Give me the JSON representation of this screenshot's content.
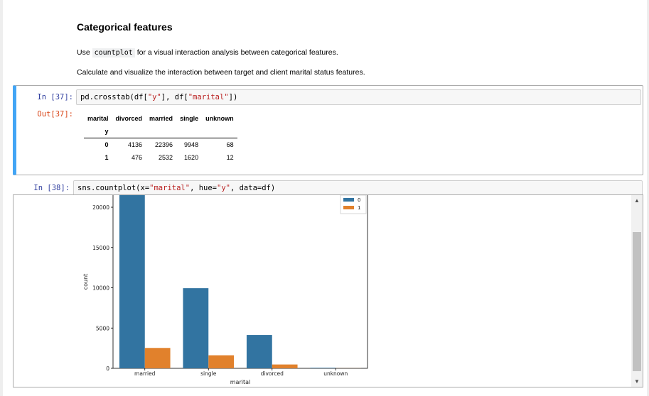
{
  "markdown": {
    "heading": "Categorical features",
    "para1_before": "Use ",
    "para1_code": "countplot",
    "para1_after": " for a visual interaction analysis between categorical features.",
    "para2": "Calculate and visualize the interaction between target and client marital status features."
  },
  "cell37": {
    "in_prompt": "In [37]:",
    "out_prompt": "Out[37]:",
    "code_prefix": "pd.crosstab(df[",
    "code_s1": "\"y\"",
    "code_mid": "], df[",
    "code_s2": "\"marital\"",
    "code_suffix": "])",
    "table": {
      "corner_label": "marital",
      "columns": [
        "divorced",
        "married",
        "single",
        "unknown"
      ],
      "index_label": "y",
      "rows": [
        {
          "index": "0",
          "values": [
            "4136",
            "22396",
            "9948",
            "68"
          ]
        },
        {
          "index": "1",
          "values": [
            "476",
            "2532",
            "1620",
            "12"
          ]
        }
      ]
    }
  },
  "cell38": {
    "in_prompt": "In [38]:",
    "code_prefix": "sns.countplot(x=",
    "code_s1": "\"marital\"",
    "code_mid": ", hue=",
    "code_s2": "\"y\"",
    "code_suffix": ", data=df)"
  },
  "chart_data": {
    "type": "bar",
    "categories": [
      "married",
      "single",
      "divorced",
      "unknown"
    ],
    "series": [
      {
        "name": "0",
        "values": [
          22396,
          9948,
          4136,
          68
        ],
        "color": "#3274a1"
      },
      {
        "name": "1",
        "values": [
          2532,
          1620,
          476,
          12
        ],
        "color": "#e1812c"
      }
    ],
    "xlabel": "marital",
    "ylabel": "count",
    "yticks": [
      0,
      5000,
      10000,
      15000,
      20000
    ],
    "ylim": [
      0,
      21500
    ],
    "legend_placement": "top-right",
    "grid": false
  },
  "colors": {
    "cell_selected_border": "#42a5f5",
    "in_prompt": "#303f9f",
    "out_prompt": "#d84315"
  }
}
